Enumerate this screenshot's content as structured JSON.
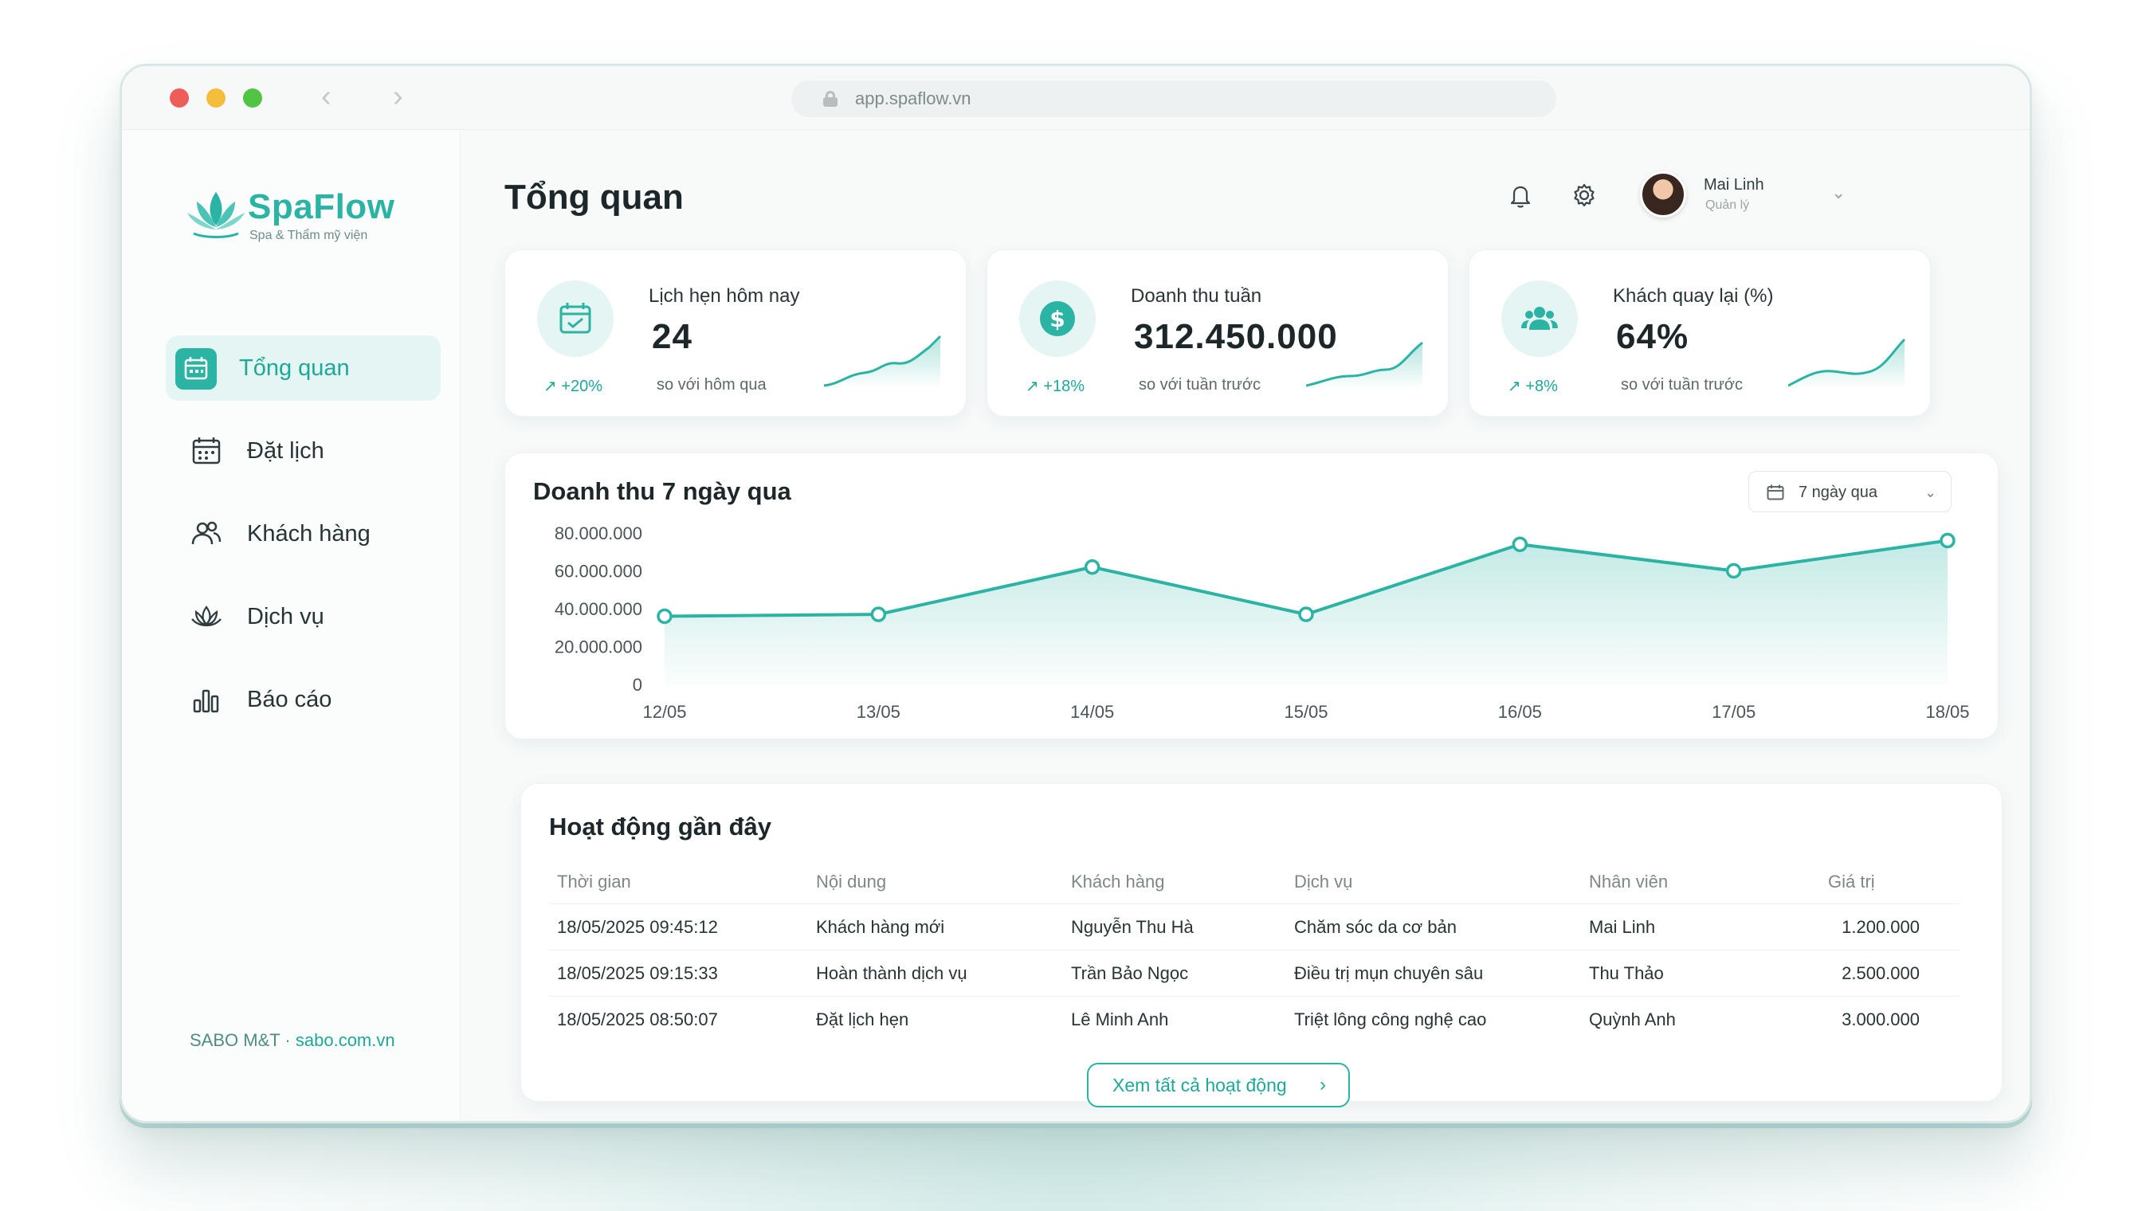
{
  "browser": {
    "url": "app.spaflow.vn",
    "back_glyph": "‹",
    "forward_glyph": "›"
  },
  "brand": {
    "name": "SpaFlow",
    "tagline": "Spa & Thẩm mỹ viện",
    "accent": "#2bb3a3"
  },
  "sidebar": {
    "items": [
      {
        "label": "Tổng quan",
        "icon": "calendar-dashboard-icon",
        "active": true
      },
      {
        "label": "Đặt lịch",
        "icon": "calendar-icon",
        "active": false
      },
      {
        "label": "Khách hàng",
        "icon": "users-icon",
        "active": false
      },
      {
        "label": "Dịch vụ",
        "icon": "lotus-icon",
        "active": false
      },
      {
        "label": "Báo cáo",
        "icon": "bar-chart-icon",
        "active": false
      }
    ],
    "footer": {
      "company": "SABO M&T",
      "separator": "·",
      "link": "sabo.com.vn"
    }
  },
  "header": {
    "title": "Tổng quan",
    "user_name": "Mai Linh",
    "user_role": "Quản lý",
    "chevron": "⌄"
  },
  "stats": [
    {
      "label": "Lịch hẹn hôm nay",
      "value": "24",
      "delta": "↗ +20%",
      "compare": "so với hôm qua",
      "icon": "calendar-check-icon"
    },
    {
      "label": "Doanh thu tuần",
      "value": "312.450.000",
      "delta": "↗ +18%",
      "compare": "so với tuần trước",
      "icon": "dollar-icon"
    },
    {
      "label": "Khách quay lại (%)",
      "value": "64%",
      "delta": "↗ +8%",
      "compare": "so với tuần trước",
      "icon": "group-icon"
    }
  ],
  "revenue_chart": {
    "title": "Doanh thu 7 ngày qua",
    "range_label": "7 ngày qua",
    "range_chevron": "⌄"
  },
  "chart_data": {
    "type": "area",
    "title": "Doanh thu 7 ngày qua",
    "xlabel": "",
    "ylabel": "",
    "categories": [
      "12/05",
      "13/05",
      "14/05",
      "15/05",
      "16/05",
      "17/05",
      "18/05"
    ],
    "values": [
      36000000,
      37000000,
      62000000,
      37000000,
      74000000,
      60000000,
      76000000
    ],
    "ylim": [
      0,
      80000000
    ],
    "yticks": [
      0,
      20000000,
      40000000,
      60000000,
      80000000
    ],
    "ytick_labels": [
      "0",
      "20.000.000",
      "40.000.000",
      "60.000.000",
      "80.000.000"
    ],
    "grid": false,
    "color": "#2bb3a3"
  },
  "activity": {
    "title": "Hoạt động gần đây",
    "columns": [
      "Thời gian",
      "Nội dung",
      "Khách hàng",
      "Dịch vụ",
      "Nhân viên",
      "Giá trị"
    ],
    "rows": [
      [
        "18/05/2025 09:45:12",
        "Khách hàng mới",
        "Nguyễn Thu Hà",
        "Chăm sóc da cơ bản",
        "Mai Linh",
        "1.200.000"
      ],
      [
        "18/05/2025 09:15:33",
        "Hoàn thành dịch vụ",
        "Trần Bảo Ngọc",
        "Điều trị mụn chuyên sâu",
        "Thu Thảo",
        "2.500.000"
      ],
      [
        "18/05/2025 08:50:07",
        "Đặt lịch hẹn",
        "Lê Minh Anh",
        "Triệt lông công nghệ cao",
        "Quỳnh Anh",
        "3.000.000"
      ]
    ],
    "view_all": "Xem tất cả hoạt động",
    "view_all_arrow": "›"
  }
}
